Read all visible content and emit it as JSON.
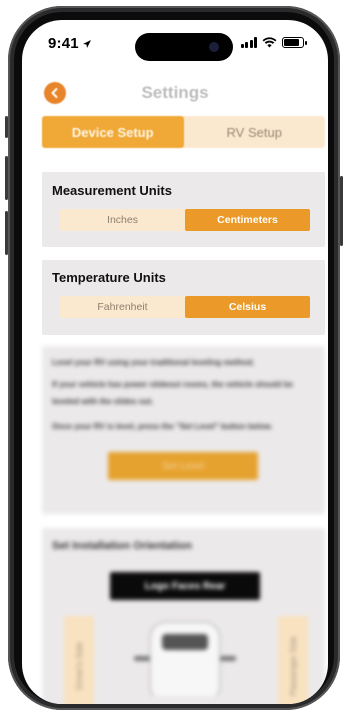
{
  "status_bar": {
    "time": "9:41"
  },
  "header": {
    "title": "Settings"
  },
  "main_tabs": [
    {
      "label": "Device Setup",
      "active": true
    },
    {
      "label": "RV Setup",
      "active": false
    }
  ],
  "measurement": {
    "title": "Measurement Units",
    "options": [
      "Inches",
      "Centimeters"
    ],
    "selected": "Centimeters"
  },
  "temperature": {
    "title": "Temperature Units",
    "options": [
      "Fahrenheit",
      "Celsius"
    ],
    "selected": "Celsius"
  },
  "leveling": {
    "paragraph1": "Level your RV using your traditional leveling method.",
    "paragraph2": "If your vehicle has power slideout rooms, the vehicle should be leveled with the slides out.",
    "paragraph3": "Once your RV is level, press the \"Set Level\" button below.",
    "button_label": "Set Level"
  },
  "orientation": {
    "title": "Set Installation Orientation",
    "button_label": "Logo Faces Rear",
    "left_side_label": "Driver's Side",
    "right_side_label": "Passenger Side"
  },
  "colors": {
    "accent": "#f0a936",
    "accent_light": "#fbe9cf",
    "card_bg": "#ece9ea"
  }
}
